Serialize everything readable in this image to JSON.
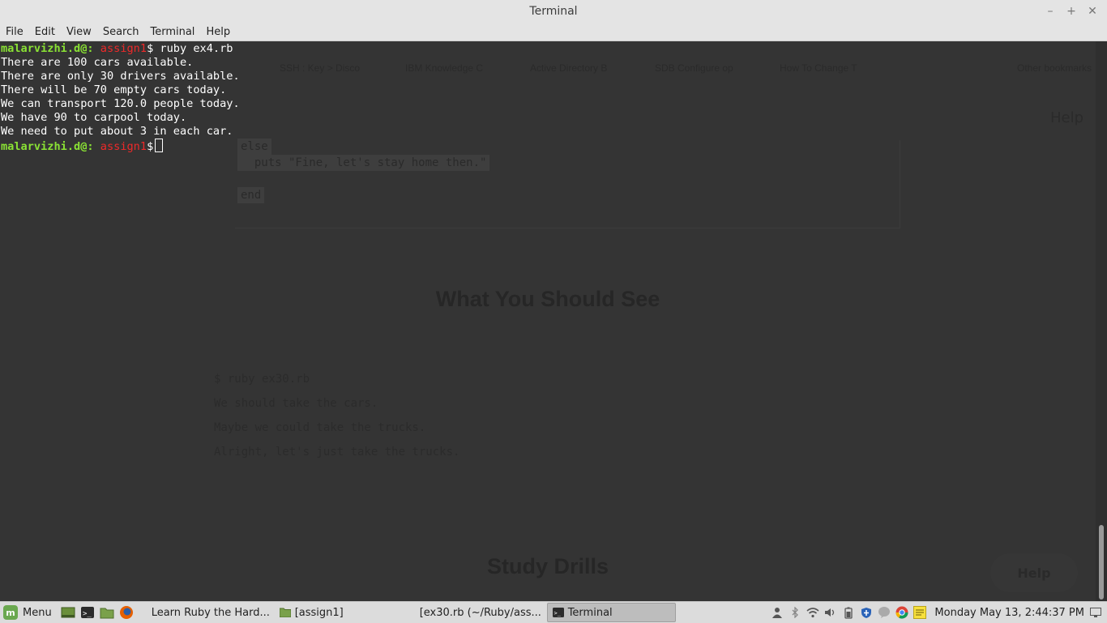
{
  "window": {
    "title": "Terminal"
  },
  "menubar": {
    "items": [
      "File",
      "Edit",
      "View",
      "Search",
      "Terminal",
      "Help"
    ]
  },
  "terminal": {
    "prompt1": {
      "user": "malarvizhi.d@:",
      "dir": "assign1",
      "sep": "$",
      "cmd": " ruby ex4.rb"
    },
    "output": [
      "There are 100 cars available.",
      "There are only 30 drivers available.",
      "There will be 70 empty cars today.",
      "We can transport 120.0 people today.",
      "We have 90 to carpool today.",
      "We need to put about 3 in each car."
    ],
    "prompt2": {
      "user": "malarvizhi.d@:",
      "dir": "assign1",
      "sep": "$"
    }
  },
  "background_page": {
    "bookmarks": [
      "SSH : Key > Disco",
      "IBM Knowledge C",
      "Active Directory B",
      "SDB Configure op",
      "How To Change T",
      "Other bookmarks"
    ],
    "help_top": "Help",
    "code": [
      "else",
      "  puts \"Fine, let's stay home then.\"",
      "end"
    ],
    "heading1": "What You Should See",
    "output_lines": [
      "$ ruby ex30.rb",
      "We should take the cars.",
      "Maybe we could take the trucks.",
      "Alright, let's just take the trucks."
    ],
    "heading2": "Study Drills",
    "help_button": "Help"
  },
  "taskbar": {
    "menu_label": "Menu",
    "tasks": [
      {
        "label": "Learn Ruby the Hard...",
        "icon": "chrome-icon"
      },
      {
        "label": "[assign1]",
        "icon": "folder-icon"
      },
      {
        "label": "[ex30.rb (~/Ruby/ass...",
        "icon": "text-editor-icon"
      },
      {
        "label": "Terminal",
        "icon": "terminal-icon"
      }
    ],
    "clock": "Monday May 13,  2:44:37 PM"
  },
  "colors": {
    "prompt_user": "#8ae234",
    "prompt_dir": "#ef2929",
    "terminal_bg": "#343434"
  }
}
